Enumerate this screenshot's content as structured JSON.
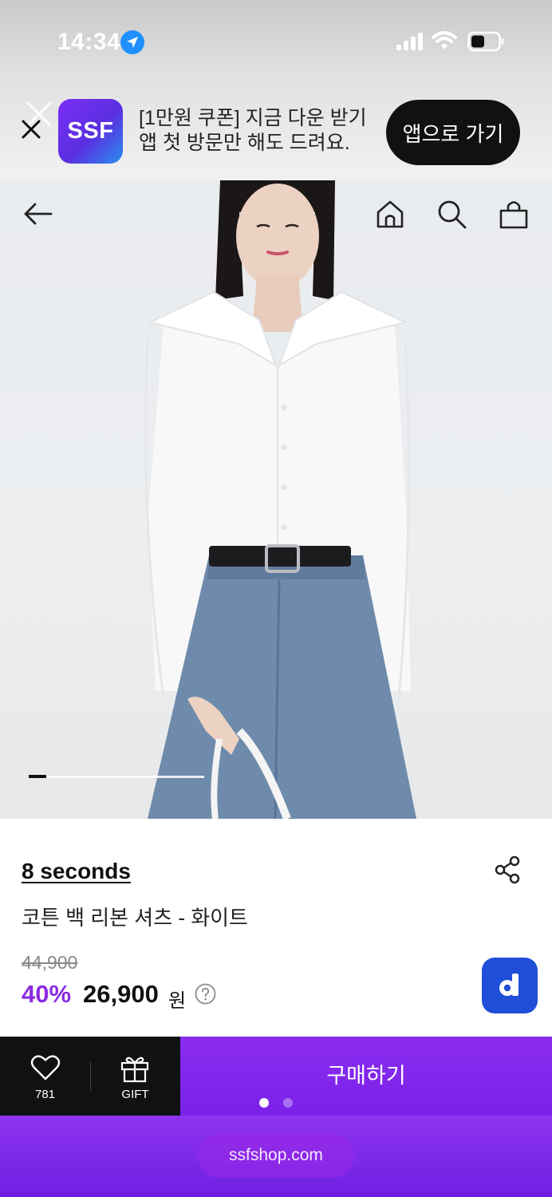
{
  "status_bar": {
    "time": "14:34"
  },
  "app_banner": {
    "logo_text": "SSF",
    "line1": "[1만원 쿠폰] 지금 다운 받기",
    "line2": "앱 첫 방문만 해도 드려요.",
    "cta_label": "앱으로 가기"
  },
  "hero": {
    "icons": [
      "back-arrow-icon",
      "home-icon",
      "search-icon",
      "shopping-bag-icon"
    ],
    "pager": {
      "current": 1,
      "total": 10
    }
  },
  "product": {
    "brand": "8 seconds",
    "name": "코튼 백 리본 셔츠 - 화이트",
    "original_price": "44,900",
    "discount": "40%",
    "sale_price": "26,900",
    "currency": "원",
    "badge_letter": "d"
  },
  "actions": {
    "like_count": "781",
    "gift_label": "GIFT",
    "buy_label": "구매하기",
    "page_dots": 2,
    "active_dot": 1
  },
  "browser": {
    "url": "ssfshop.com"
  },
  "colors": {
    "accent": "#8a2be2",
    "buy_button": "#8a2cf0",
    "d_badge": "#1f4ed8",
    "action_bar_dark": "#111111"
  }
}
